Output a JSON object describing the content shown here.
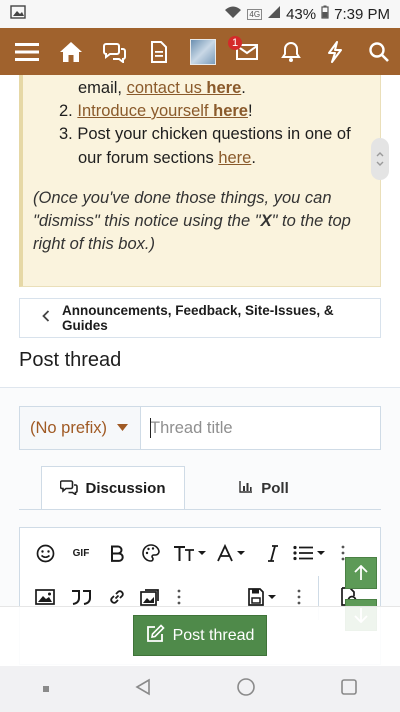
{
  "status": {
    "battery": "43%",
    "time": "7:39 PM",
    "network": "4G"
  },
  "header": {
    "notification_count": "1"
  },
  "notice": {
    "line1_pre": "email, ",
    "line1_link": "contact us ",
    "line1_strong": "here",
    "line1_post": ".",
    "item2_num": "2.",
    "item2_link": "Introduce yourself ",
    "item2_strong": "here",
    "item2_post": "!",
    "item3_num": "3.",
    "item3_text": "Post your chicken questions in one of",
    "item3_text2": "our forum sections ",
    "item3_link": "here",
    "item3_post": ".",
    "dismiss_line1": "(Once you've done those things, you can",
    "dismiss_line2_pre": "\"dismiss\" this notice using the \"",
    "dismiss_x": "X",
    "dismiss_line2_post": "\" to the top",
    "dismiss_line3": "right of this box.)"
  },
  "breadcrumb": {
    "label": "Announcements, Feedback, Site-Issues, & Guides"
  },
  "page": {
    "title": "Post thread"
  },
  "form": {
    "prefix_selected": "(No prefix)",
    "title_placeholder": "Thread title"
  },
  "tabs": [
    {
      "label": "Discussion"
    },
    {
      "label": "Poll"
    }
  ],
  "toolbar": {
    "gif_label": "GIF"
  },
  "actions": {
    "post_thread_label": "Post thread"
  }
}
